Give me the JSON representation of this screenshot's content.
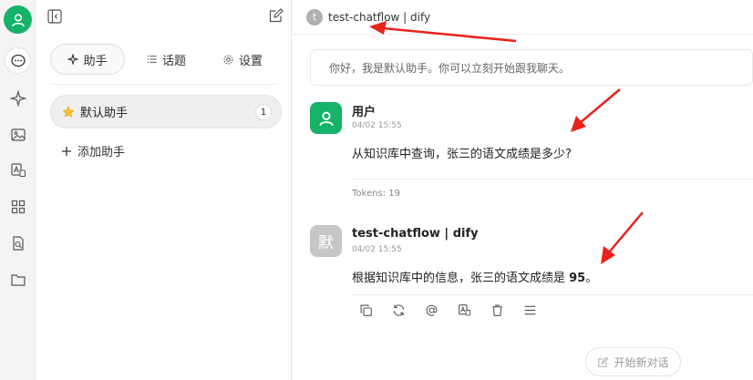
{
  "sidebar": {
    "tabs": [
      {
        "label": "助手",
        "icon": "sparkle-icon"
      },
      {
        "label": "话题",
        "icon": "list-icon"
      },
      {
        "label": "设置",
        "icon": "gear-icon"
      }
    ],
    "assistant": {
      "label": "默认助手",
      "count": "1"
    },
    "add_assistant_label": "添加助手"
  },
  "header": {
    "avatar_letter": "t",
    "title": "test-chatflow | dify"
  },
  "chat": {
    "greeting": "你好，我是默认助手。你可以立刻开始跟我聊天。",
    "user_message": {
      "name": "用户",
      "time": "04/02 15:55",
      "content": "从知识库中查询，张三的语文成绩是多少?",
      "tokens": "Tokens: 19"
    },
    "bot_message": {
      "avatar_char": "默",
      "name": "test-chatflow | dify",
      "time": "04/02 15:55",
      "content_prefix": "根据知识库中的信息，张三的语文成绩是 ",
      "content_bold": "95",
      "content_suffix": "。"
    },
    "new_chat_label": "开始新对话"
  },
  "colors": {
    "accent_green": "#17b26a",
    "annotation_red": "#e8231c"
  }
}
